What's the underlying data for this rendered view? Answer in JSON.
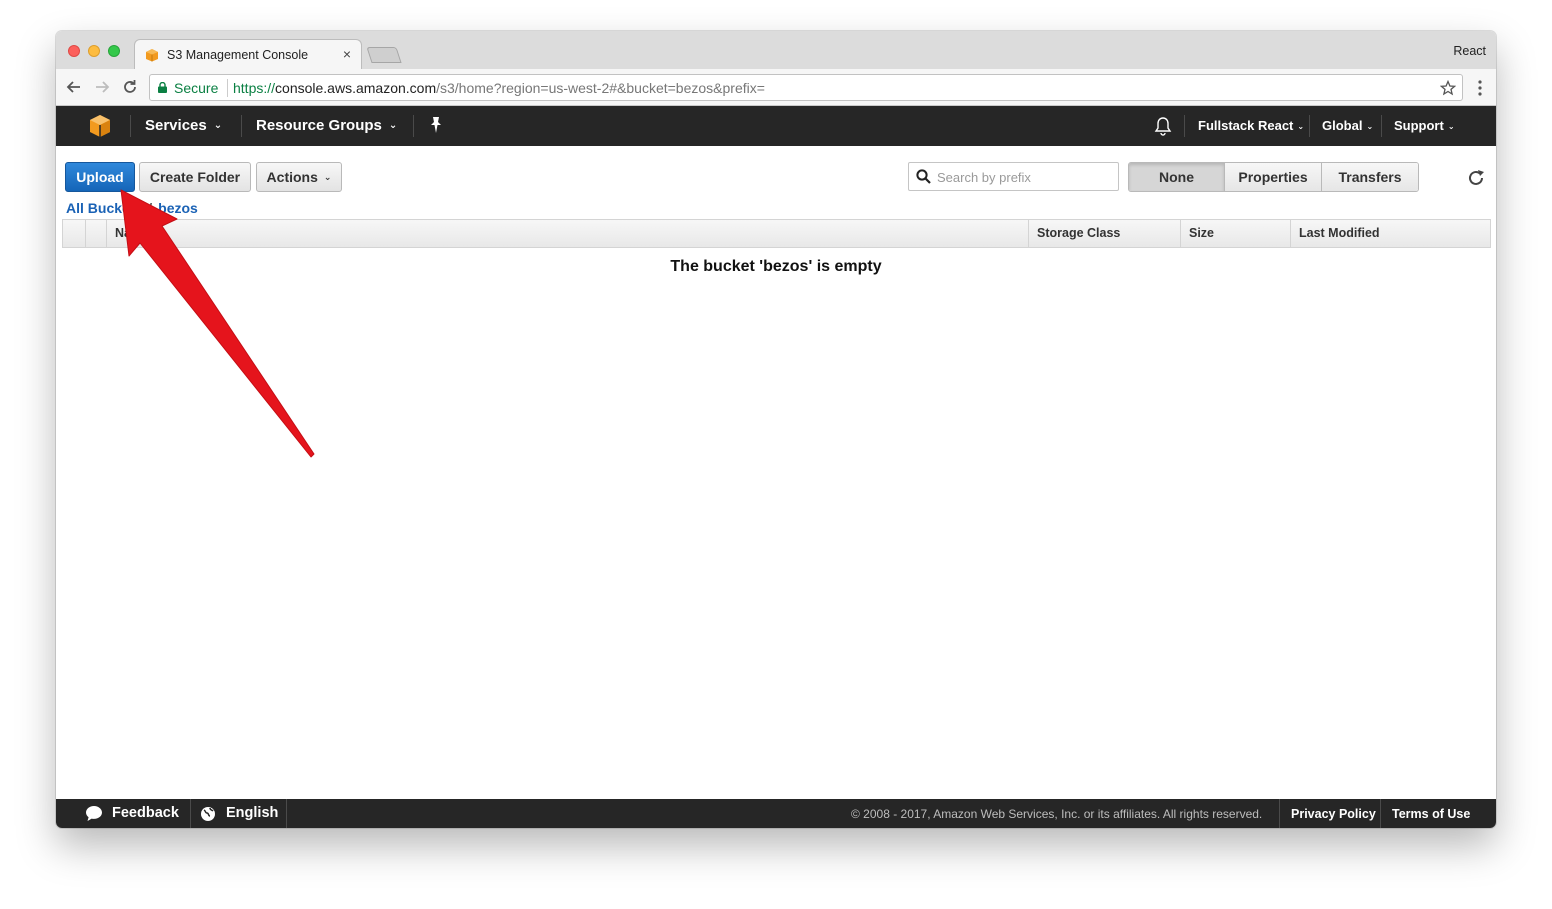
{
  "browser": {
    "tab_title": "S3 Management Console",
    "tab_close": "×",
    "profile_name": "React",
    "secure_label": "Secure",
    "url_scheme": "https://",
    "url_host": "console.aws.amazon.com",
    "url_path": "/s3/home?region=us-west-2#&bucket=bezos&prefix="
  },
  "aws_nav": {
    "services": "Services",
    "resource_groups": "Resource Groups",
    "account": "Fullstack React",
    "region": "Global",
    "support": "Support",
    "chevron": "⌄"
  },
  "toolbar": {
    "upload": "Upload",
    "create_folder": "Create Folder",
    "actions": "Actions",
    "search_placeholder": "Search by prefix",
    "view_none": "None",
    "view_properties": "Properties",
    "view_transfers": "Transfers"
  },
  "breadcrumb": {
    "root": "All Buckets",
    "separator": "/",
    "bucket": "bezos"
  },
  "table": {
    "columns": [
      "Name",
      "Storage Class",
      "Size",
      "Last Modified"
    ],
    "empty_message": "The bucket 'bezos' is empty"
  },
  "footer": {
    "feedback": "Feedback",
    "language": "English",
    "copyright": "© 2008 - 2017, Amazon Web Services, Inc. or its affiliates. All rights reserved.",
    "privacy": "Privacy Policy",
    "terms": "Terms of Use"
  },
  "colors": {
    "primary_button": "#1565b8",
    "nav_background": "#262626",
    "link": "#1a62b5",
    "annotation_arrow": "#e5141c",
    "aws_logo": "#f29a1f"
  }
}
